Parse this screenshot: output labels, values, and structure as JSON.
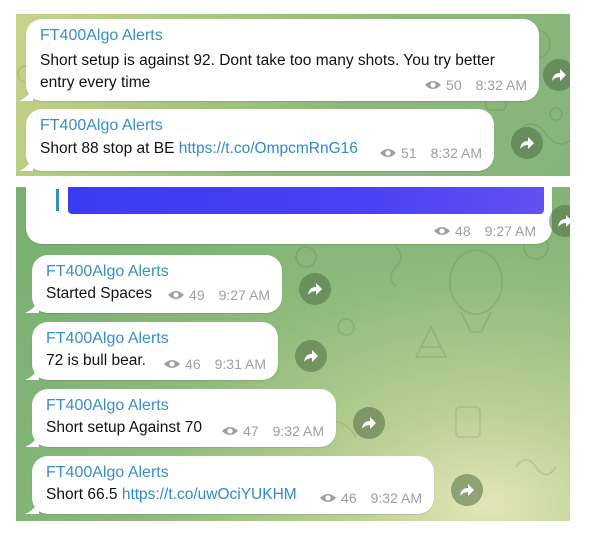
{
  "colors": {
    "author": "#3a8fc2",
    "link": "#2f8ac7",
    "meta": "#9ba0a4",
    "media": "#4a3ff6"
  },
  "icons": {
    "views": "eye-icon",
    "forward": "share-arrow-icon"
  },
  "top_messages": [
    {
      "author": "FT400Algo Alerts",
      "line1": "Short setup is against 92. Dont take too many shots. You try better",
      "line2": "entry every time",
      "views": "50",
      "time": "8:32 AM"
    },
    {
      "author": "FT400Algo Alerts",
      "text": "Short 88 stop at BE ",
      "link": "https://t.co/OmpcmRnG16",
      "views": "51",
      "time": "8:32 AM"
    }
  ],
  "media_message": {
    "views": "48",
    "time": "9:27 AM"
  },
  "bottom_messages": [
    {
      "author": "FT400Algo Alerts",
      "text": "Started Spaces",
      "views": "49",
      "time": "9:27 AM"
    },
    {
      "author": "FT400Algo Alerts",
      "text": "72 is bull bear.",
      "views": "46",
      "time": "9:31 AM"
    },
    {
      "author": "FT400Algo Alerts",
      "text": "Short setup Against 70",
      "views": "47",
      "time": "9:32 AM"
    },
    {
      "author": "FT400Algo Alerts",
      "text": "Short 66.5 ",
      "link": "https://t.co/uwOciYUKHM",
      "views": "46",
      "time": "9:32 AM"
    }
  ]
}
